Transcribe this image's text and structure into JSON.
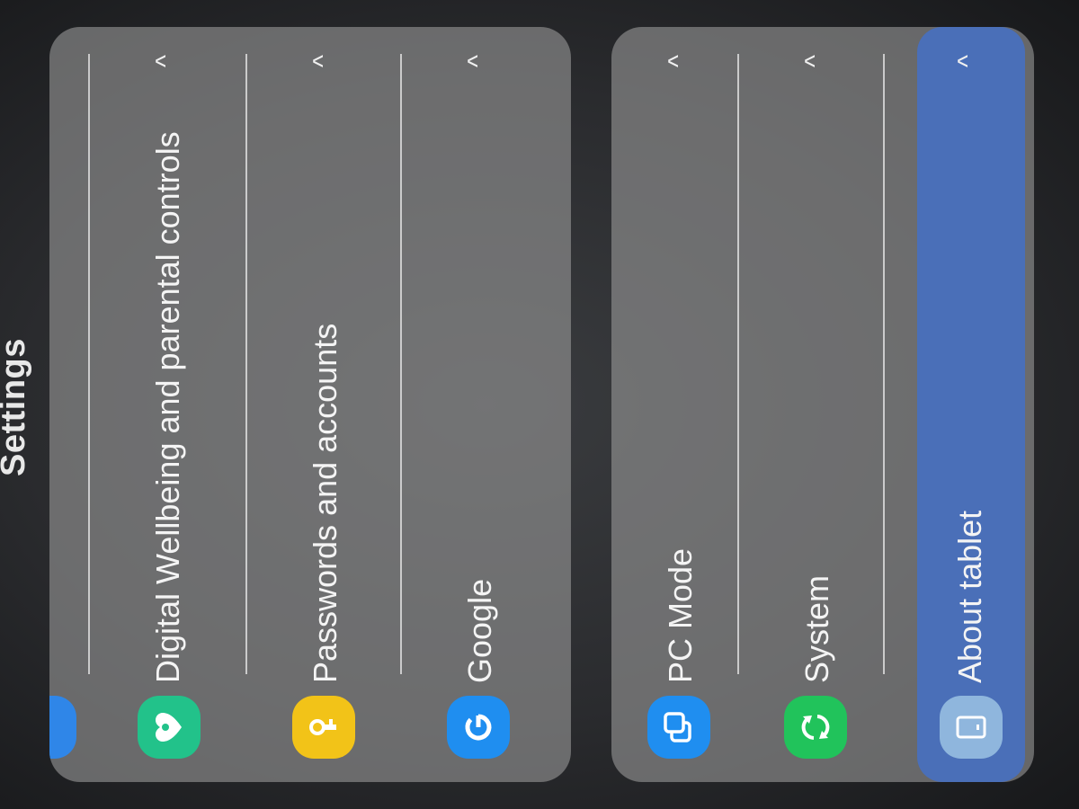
{
  "header": {
    "title": "Settings"
  },
  "groups": [
    {
      "items": [
        {
          "label": "Digital Wellbeing and parental controls",
          "icon": "heart-icon",
          "icon_color": "#22c28a",
          "chevron": "^"
        },
        {
          "label": "Passwords and accounts",
          "icon": "key-icon",
          "icon_color": "#f2c318",
          "chevron": "^"
        },
        {
          "label": "Google",
          "icon": "google-g-icon",
          "icon_color": "#1f8ef0",
          "chevron": "^"
        }
      ]
    },
    {
      "items": [
        {
          "label": "PC Mode",
          "icon": "pc-mode-icon",
          "icon_color": "#1f8ef0",
          "chevron": "^"
        },
        {
          "label": "System",
          "icon": "sync-icon",
          "icon_color": "#21c35b",
          "chevron": "^"
        },
        {
          "label": "About tablet",
          "icon": "tablet-icon",
          "icon_color": "#8fb6dd",
          "chevron": "^",
          "selected": true
        }
      ]
    }
  ],
  "colors": {
    "card_bg": "#969696",
    "selected_bg": "#4a6fb8",
    "background": "#2a2b2e"
  }
}
